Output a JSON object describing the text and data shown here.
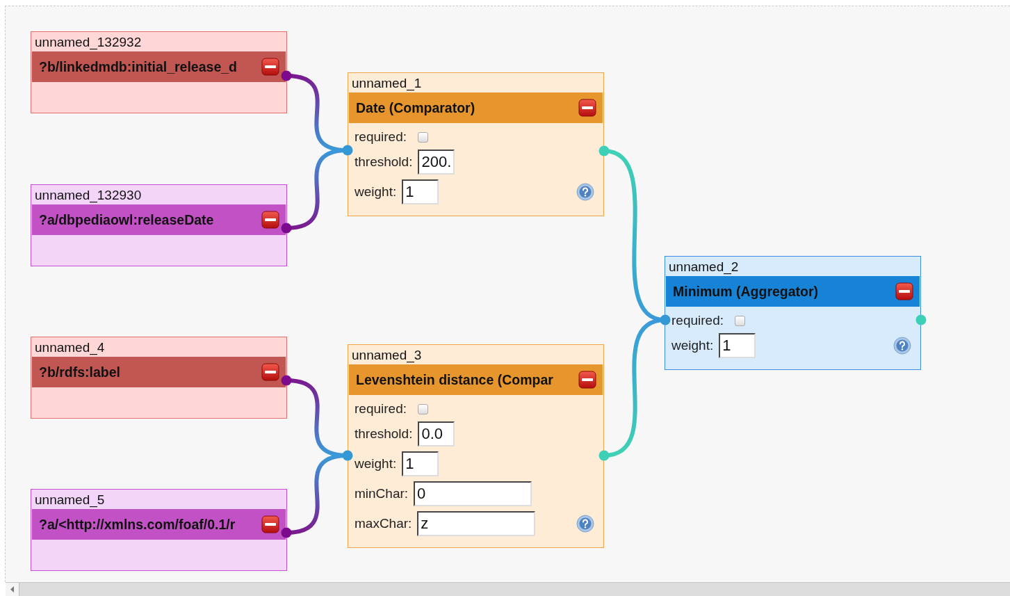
{
  "sources": [
    {
      "label": "unnamed_132932",
      "path": "?b/linkedmdb:initial_release_d",
      "kind": "target"
    },
    {
      "label": "unnamed_132930",
      "path": "?a/dbpediaowl:releaseDate",
      "kind": "source"
    },
    {
      "label": "unnamed_4",
      "path": "?b/rdfs:label",
      "kind": "target"
    },
    {
      "label": "unnamed_5",
      "path": "?a/<http://xmlns.com/foaf/0.1/r",
      "kind": "source"
    }
  ],
  "operators": [
    {
      "label": "unnamed_1",
      "title": "Date (Comparator)",
      "kind": "comparator",
      "params": [
        {
          "name": "required:",
          "kind": "checkbox",
          "checked": false
        },
        {
          "name": "threshold:",
          "kind": "short",
          "value": "200."
        },
        {
          "name": "weight:",
          "kind": "short",
          "value": "1"
        }
      ]
    },
    {
      "label": "unnamed_3",
      "title": "Levenshtein distance (Compar",
      "kind": "comparator",
      "params": [
        {
          "name": "required:",
          "kind": "checkbox",
          "checked": false
        },
        {
          "name": "threshold:",
          "kind": "short",
          "value": "0.0"
        },
        {
          "name": "weight:",
          "kind": "short",
          "value": "1"
        },
        {
          "name": "minChar:",
          "kind": "long",
          "value": "0"
        },
        {
          "name": "maxChar:",
          "kind": "long",
          "value": "z"
        }
      ]
    },
    {
      "label": "unnamed_2",
      "title": "Minimum (Aggregator)",
      "kind": "aggregator",
      "params": [
        {
          "name": "required:",
          "kind": "checkbox",
          "checked": false
        },
        {
          "name": "weight:",
          "kind": "short",
          "value": "1"
        }
      ]
    }
  ]
}
